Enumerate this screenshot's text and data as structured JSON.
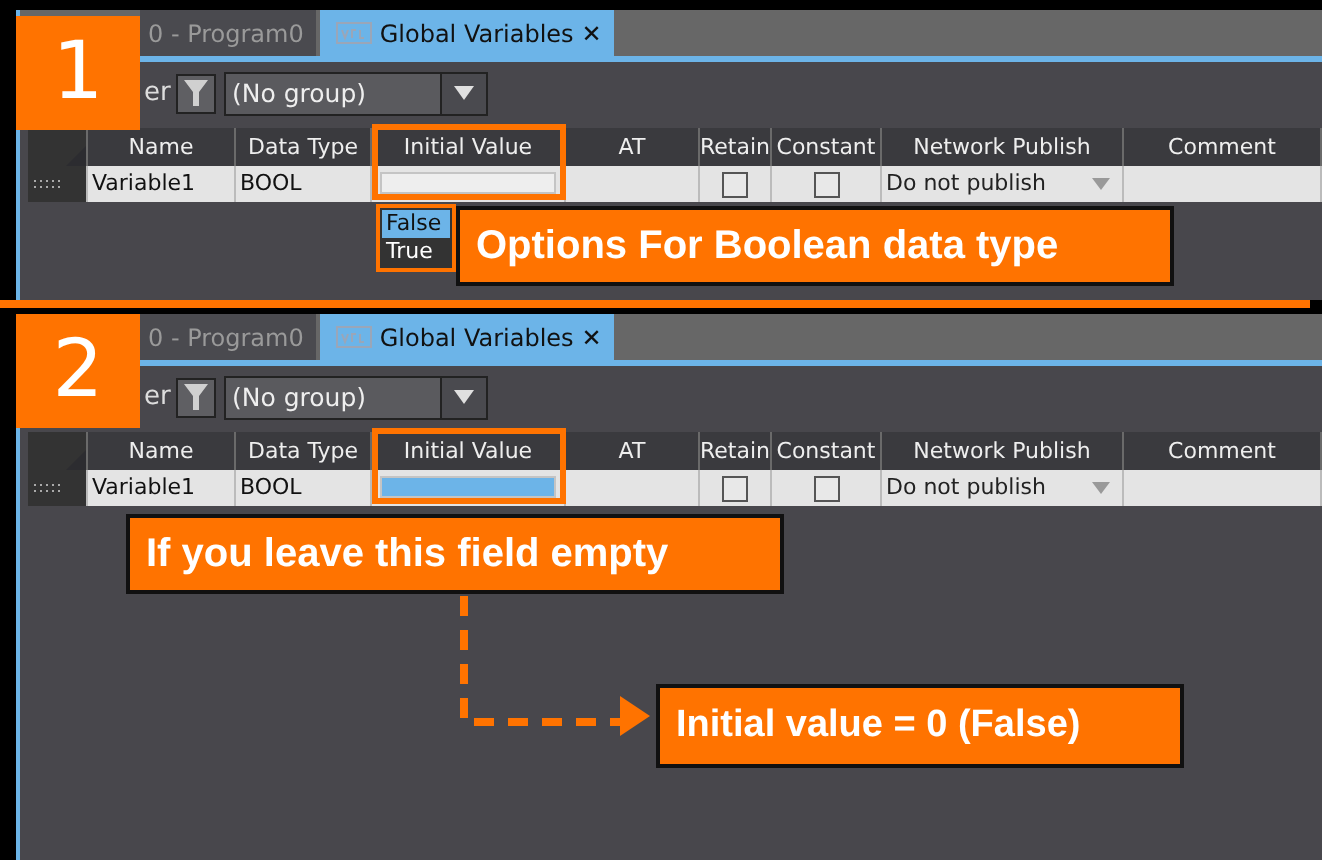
{
  "panels": [
    {
      "badge": "1",
      "tabs": [
        {
          "label": "0 - Program0",
          "kind": "program",
          "selected": false
        },
        {
          "label": "Global Variables",
          "kind": "variables",
          "selected": true,
          "close": "✕"
        }
      ],
      "filter_label": "er",
      "group": "(No group)",
      "columns": [
        "Name",
        "Data Type",
        "Initial Value",
        "AT",
        "Retain",
        "Constant",
        "Network Publish",
        "Comment"
      ],
      "rows": [
        {
          "name": "Variable1",
          "data_type": "BOOL",
          "initial_value_selected": false,
          "retain": false,
          "constant": false,
          "network_publish": "Do not publish"
        }
      ],
      "options": [
        {
          "label": "False",
          "selected": true
        },
        {
          "label": "True",
          "selected": false
        }
      ],
      "callouts": [
        {
          "text": "Options For Boolean data type",
          "kind": "options"
        }
      ]
    },
    {
      "badge": "2",
      "tabs": [
        {
          "label": "0 - Program0",
          "kind": "program",
          "selected": false
        },
        {
          "label": "Global Variables",
          "kind": "variables",
          "selected": true,
          "close": "✕"
        }
      ],
      "filter_label": "er",
      "group": "(No group)",
      "columns": [
        "Name",
        "Data Type",
        "Initial Value",
        "AT",
        "Retain",
        "Constant",
        "Network Publish",
        "Comment"
      ],
      "rows": [
        {
          "name": "Variable1",
          "data_type": "BOOL",
          "initial_value_selected": true,
          "retain": false,
          "constant": false,
          "network_publish": "Do not publish"
        }
      ],
      "callouts": [
        {
          "text": "If you leave this field empty",
          "kind": "empty"
        },
        {
          "text": "Initial value = 0 (False)",
          "kind": "result"
        }
      ]
    }
  ]
}
